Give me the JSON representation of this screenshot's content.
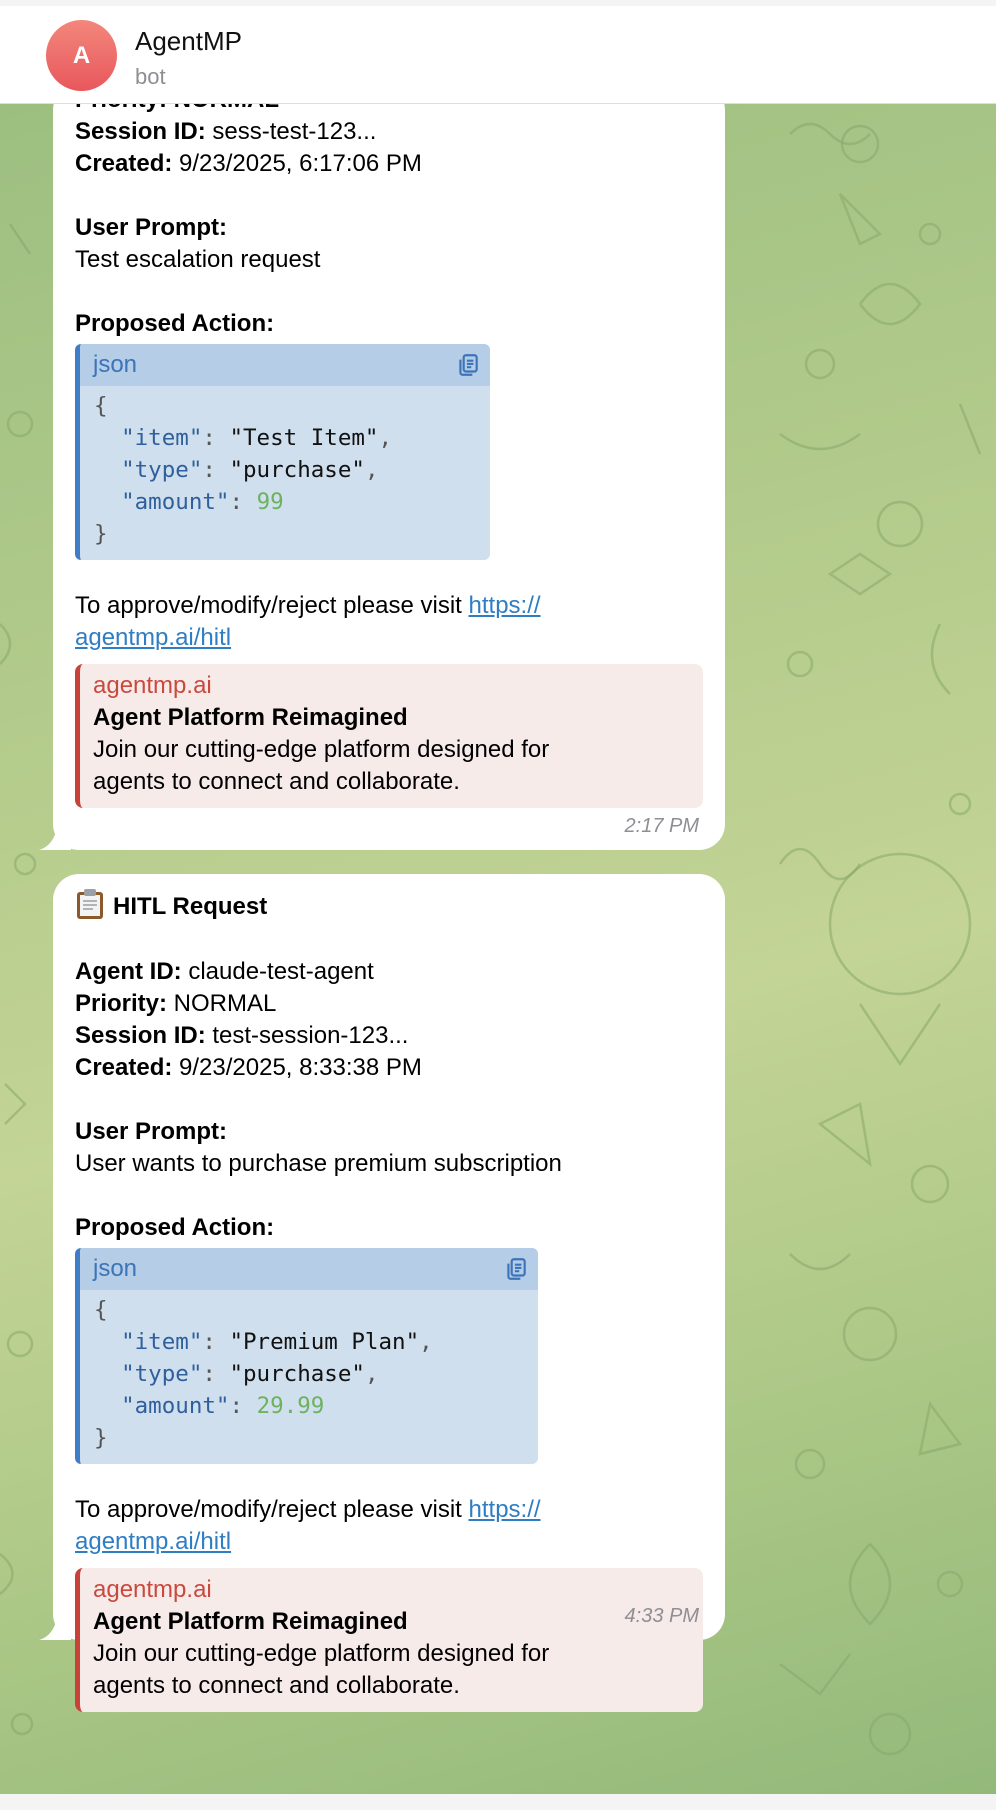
{
  "header": {
    "avatar_letter": "A",
    "title": "AgentMP",
    "subtitle": "bot"
  },
  "messages": [
    {
      "partial_top": "Priority: NORMAL",
      "fields": [
        {
          "label": "Session ID:",
          "value": " sess-test-123..."
        },
        {
          "label": "Created:",
          "value": " 9/23/2025, 6:17:06 PM"
        }
      ],
      "user_prompt_label": "User Prompt:",
      "user_prompt": "Test escalation request",
      "proposed_action_label": "Proposed Action:",
      "code_lang": "json",
      "code": {
        "item": "\"Test Item\"",
        "type": "\"purchase\"",
        "amount": "99"
      },
      "visit_text": "To approve/modify/reject please visit ",
      "link_line1": "https://",
      "link_line2": "agentmp.ai/hitl",
      "preview": {
        "site": "agentmp.ai",
        "title": "Agent Platform Reimagined",
        "desc1": "Join our cutting-edge platform designed for",
        "desc2": "agents to connect and collaborate."
      },
      "time": "2:17 PM"
    },
    {
      "icon": "clipboard-icon",
      "heading": "HITL Request",
      "fields": [
        {
          "label": "Agent ID:",
          "value": " claude-test-agent"
        },
        {
          "label": "Priority:",
          "value": " NORMAL"
        },
        {
          "label": "Session ID:",
          "value": " test-session-123..."
        },
        {
          "label": "Created:",
          "value": " 9/23/2025, 8:33:38 PM"
        }
      ],
      "user_prompt_label": "User Prompt:",
      "user_prompt": "User wants to purchase premium subscription",
      "proposed_action_label": "Proposed Action:",
      "code_lang": "json",
      "code": {
        "item": "\"Premium Plan\"",
        "type": "\"purchase\"",
        "amount": "29.99"
      },
      "visit_text": "To approve/modify/reject please visit ",
      "link_line1": "https://",
      "link_line2": "agentmp.ai/hitl",
      "preview": {
        "site": "agentmp.ai",
        "title": "Agent Platform Reimagined",
        "desc1": "Join our cutting-edge platform designed for",
        "desc2": "agents to connect and collaborate."
      },
      "time": "4:33 PM"
    }
  ],
  "code_keys": {
    "item": "\"item\"",
    "type": "\"type\"",
    "amount": "\"amount\""
  },
  "colors": {
    "accent": "#3f7dc6",
    "link": "#2f7ec4",
    "preview_bar": "#c9423a",
    "avatar": "#e8575c"
  }
}
